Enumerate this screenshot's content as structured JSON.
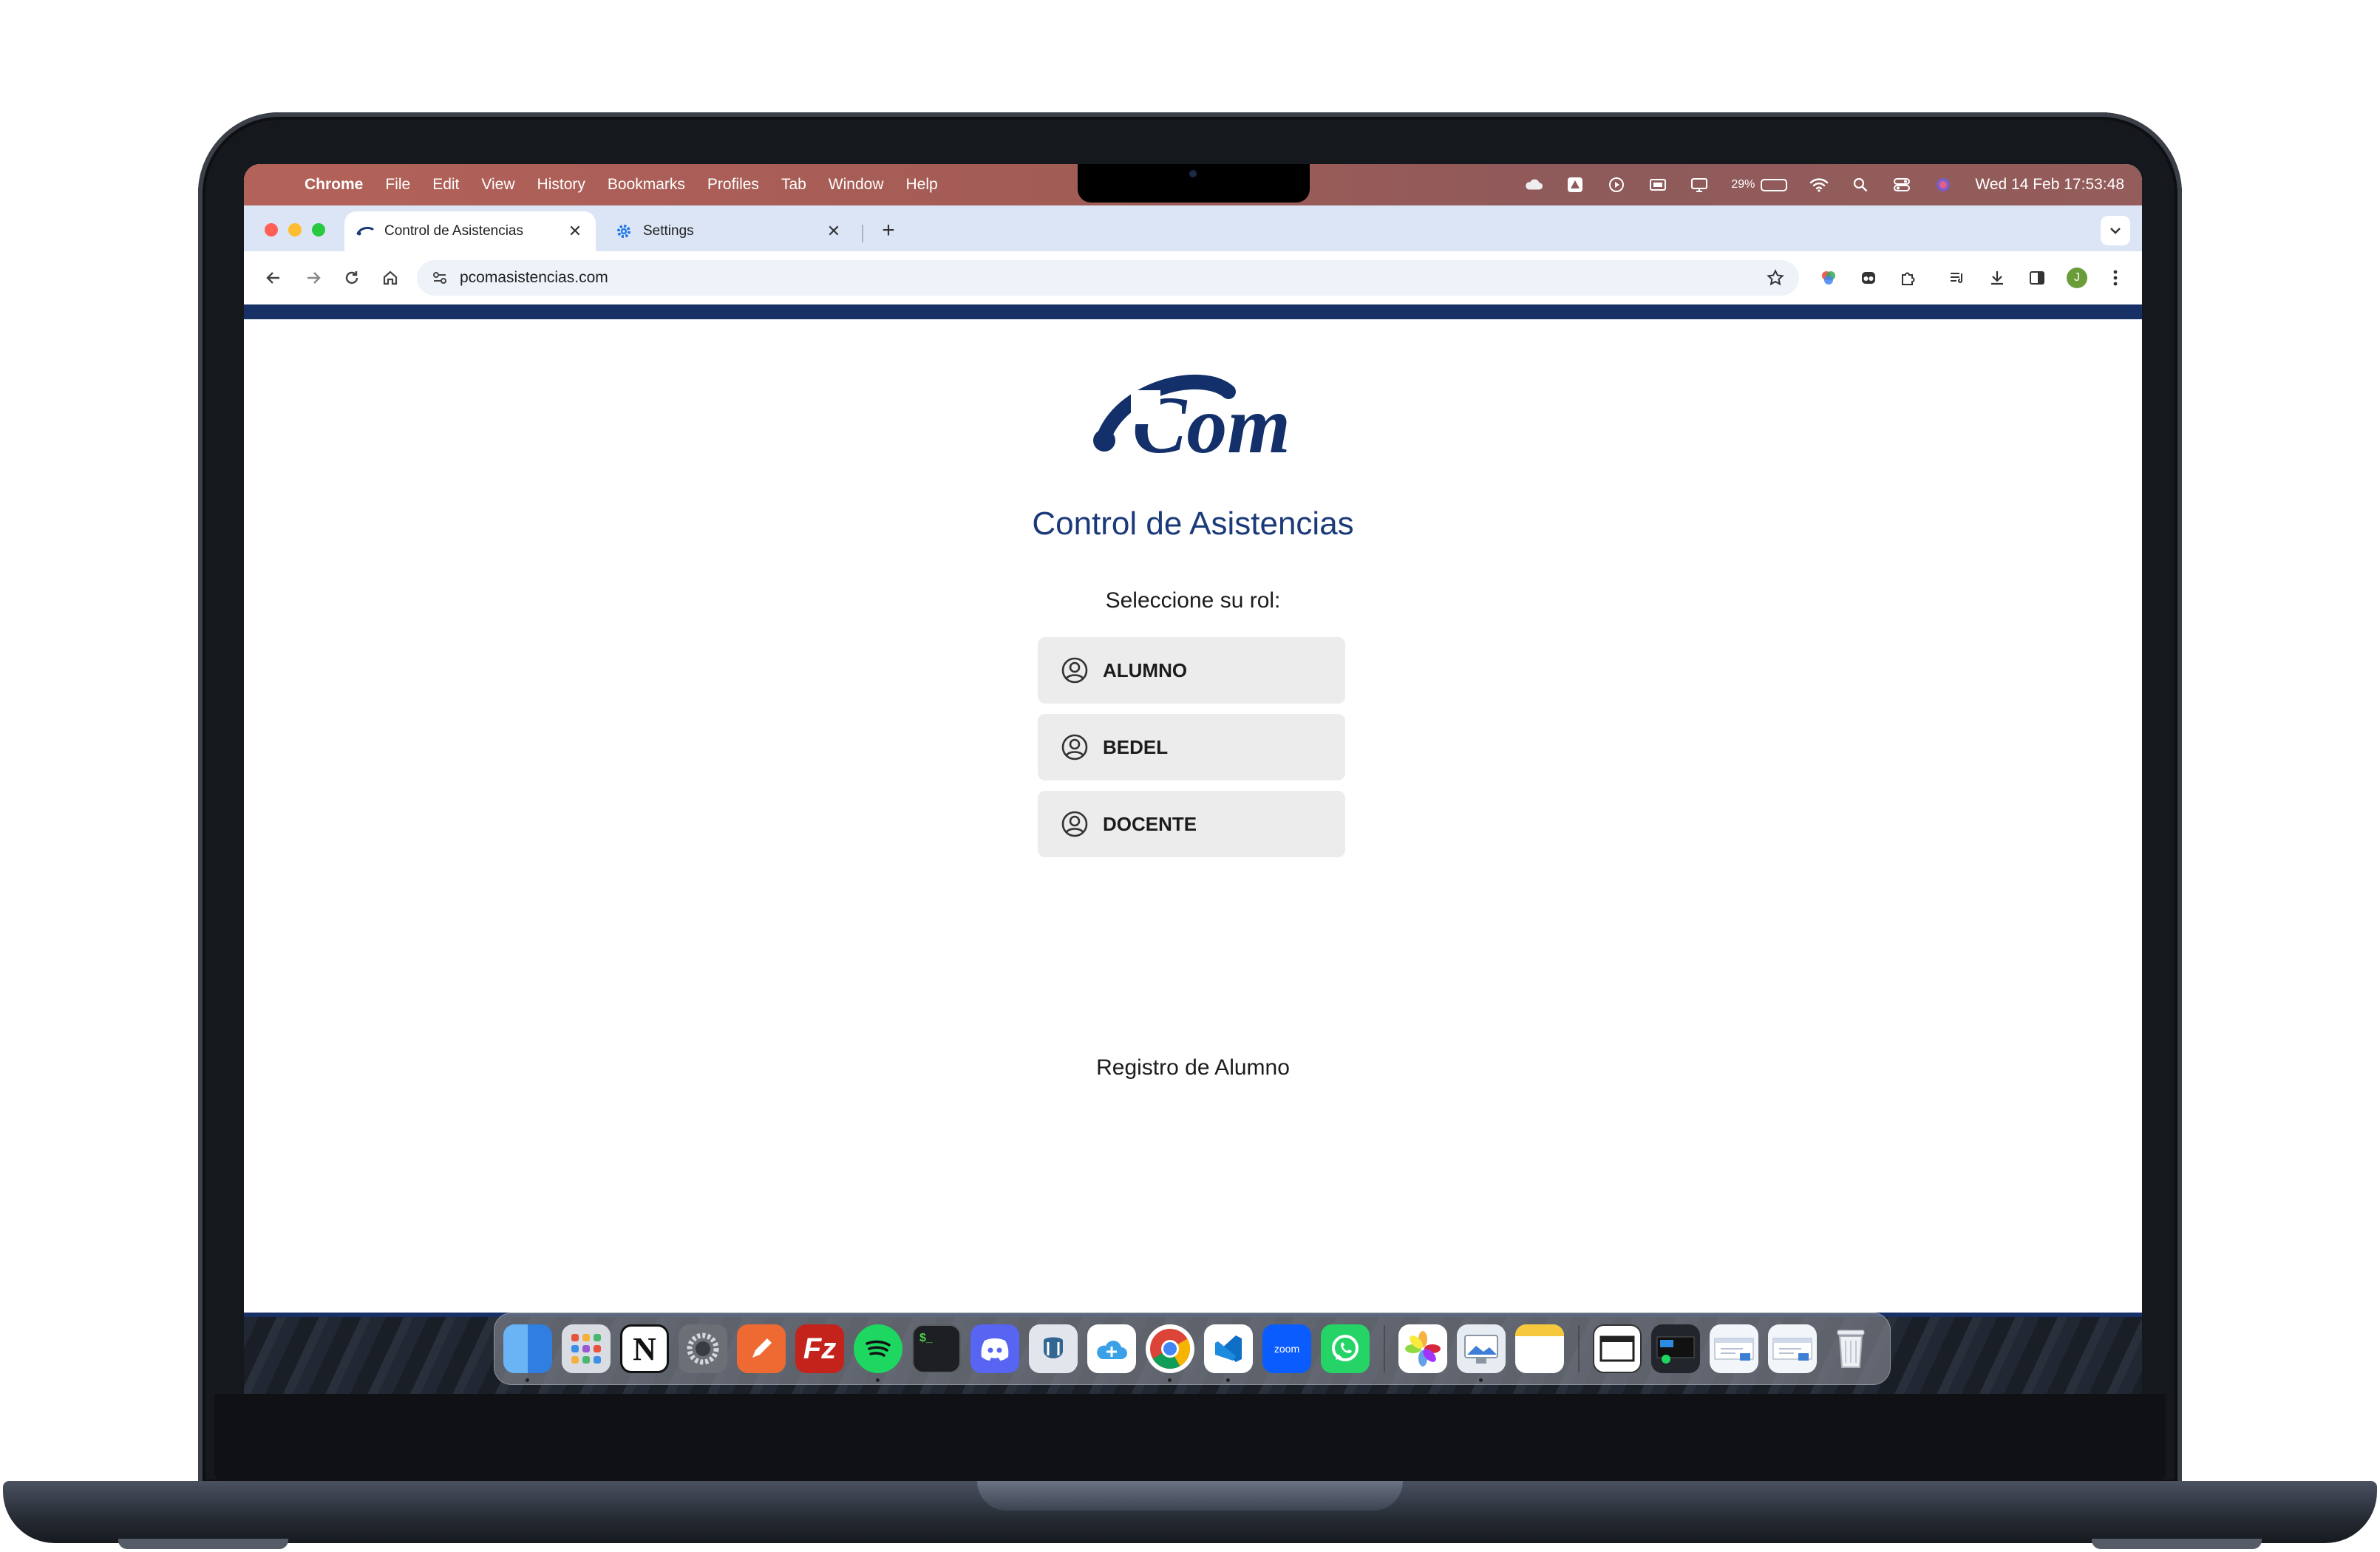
{
  "menubar": {
    "app_name": "Chrome",
    "items": [
      "File",
      "Edit",
      "View",
      "History",
      "Bookmarks",
      "Profiles",
      "Tab",
      "Window",
      "Help"
    ],
    "battery_percent": "29%",
    "battery_level": 0.29,
    "clock": "Wed 14 Feb  17:53:48"
  },
  "tabs": [
    {
      "title": "Control de Asistencias",
      "active": true
    },
    {
      "title": "Settings",
      "active": false
    }
  ],
  "toolbar": {
    "url": "pcomasistencias.com",
    "profile_initial": "J"
  },
  "page": {
    "logo_text": "Com",
    "title": "Control de Asistencias",
    "prompt": "Seleccione su rol:",
    "roles": [
      "ALUMNO",
      "BEDEL",
      "DOCENTE"
    ],
    "register_link": "Registro de Alumno"
  },
  "dock": {
    "zoom_label": "zoom"
  },
  "colors": {
    "brand_navy": "#1b3a78",
    "strip_navy": "#173066",
    "button_bg": "#ececec"
  }
}
